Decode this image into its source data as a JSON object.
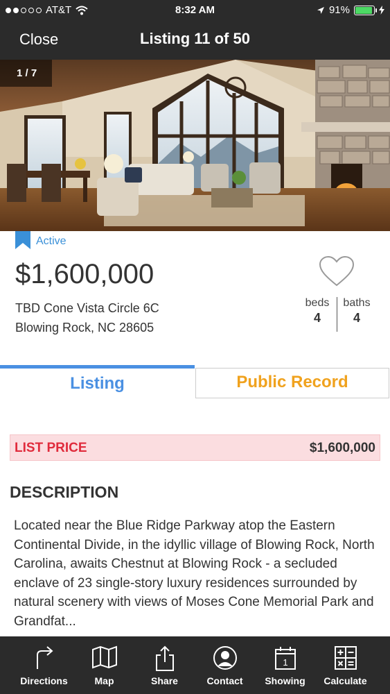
{
  "status_bar": {
    "carrier": "AT&T",
    "time": "8:32 AM",
    "battery": "91%",
    "battery_level": 0.91
  },
  "nav": {
    "close_label": "Close",
    "title": "Listing 11 of 50"
  },
  "hero": {
    "counter": "1 / 7"
  },
  "listing": {
    "status": "Active",
    "price": "$1,600,000",
    "address_line1": "TBD Cone Vista Circle 6C",
    "address_line2": "Blowing Rock, NC 28605",
    "beds_label": "beds",
    "beds": "4",
    "baths_label": "baths",
    "baths": "4"
  },
  "tabs": {
    "listing": "Listing",
    "public_record": "Public Record"
  },
  "list_price": {
    "label": "LIST PRICE",
    "value": "$1,600,000"
  },
  "description": {
    "heading": "DESCRIPTION",
    "text": "Located near the Blue Ridge Parkway atop the Eastern Continental Divide, in the idyllic village of Blowing Rock, North Carolina, awaits Chestnut at Blowing Rock - a secluded enclave of 23 single-story luxury residences surrounded by natural scenery with views of Moses Cone Memorial Park and Grandfat..."
  },
  "toolbar": {
    "directions": "Directions",
    "map": "Map",
    "share": "Share",
    "contact": "Contact",
    "showing": "Showing",
    "showing_icon_number": "1",
    "calculate": "Calculate"
  },
  "colors": {
    "bar_bg": "#2b2b2b",
    "accent_blue": "#4a90e2",
    "accent_orange": "#f0a21e",
    "price_red": "#e02b3c",
    "battery_green": "#4cd964"
  }
}
